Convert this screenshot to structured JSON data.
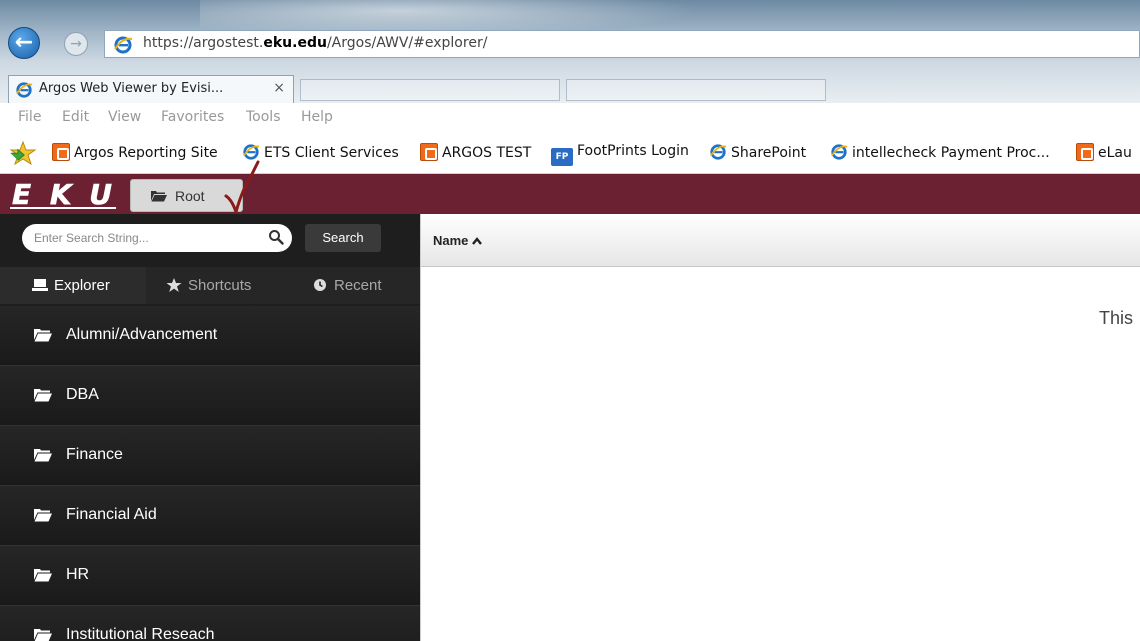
{
  "browser": {
    "address_url_prefix": "https://argostest.",
    "address_url_domain": "eku.edu",
    "address_url_suffix": "/Argos/AWV/#explorer/",
    "active_tab_title": "Argos Web Viewer by Evisi...",
    "tab_close": "×"
  },
  "menubar": {
    "items": [
      "File",
      "Edit",
      "View",
      "Favorites",
      "Tools",
      "Help"
    ]
  },
  "favorites": [
    {
      "label": "Argos Reporting Site",
      "icon": "argos-icon"
    },
    {
      "label": "ETS Client Services",
      "icon": "ie-icon"
    },
    {
      "label": "ARGOS TEST",
      "icon": "argos-icon"
    },
    {
      "label": "FootPrints Login",
      "icon": "footprints-icon",
      "badge": "FP"
    },
    {
      "label": "SharePoint",
      "icon": "ie-icon"
    },
    {
      "label": "intellecheck Payment Proc...",
      "icon": "ie-icon"
    },
    {
      "label": "eLau",
      "icon": "argos-icon"
    }
  ],
  "appbar": {
    "logo_text": "EKU",
    "root_label": "Root"
  },
  "sidebar": {
    "search_placeholder": "Enter Search String...",
    "search_button": "Search",
    "tabs": [
      {
        "label": "Explorer",
        "icon": "laptop-icon",
        "active": true
      },
      {
        "label": "Shortcuts",
        "icon": "star-icon",
        "active": false
      },
      {
        "label": "Recent",
        "icon": "clock-icon",
        "active": false
      }
    ],
    "folders": [
      "Alumni/Advancement",
      "DBA",
      "Finance",
      "Financial Aid",
      "HR",
      "Institutional Reseach"
    ]
  },
  "main": {
    "column_name": "Name",
    "empty_message": "This"
  },
  "colors": {
    "appbar": "#6b2132",
    "sidebar": "#1e1e1e",
    "accent_blue": "#1a5fa8"
  }
}
